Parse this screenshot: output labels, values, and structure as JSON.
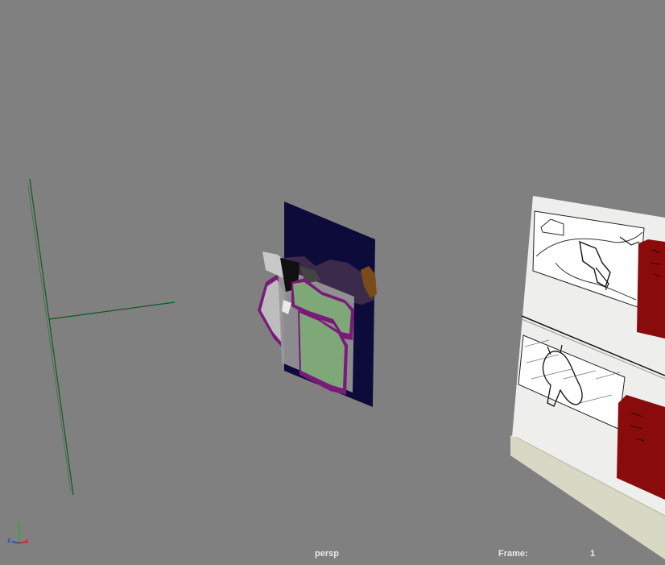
{
  "viewport": {
    "camera_name": "persp",
    "frame_label": "Frame:",
    "frame_value": "1"
  },
  "axis_gizmo": {
    "x_label": "x",
    "y_label": "y",
    "z_label": "z",
    "x_color": "#d02020",
    "y_color": "#20b020",
    "z_color": "#2040d0"
  },
  "colors": {
    "background": "#808080",
    "grid_line": "#0e5a1e",
    "dark_panel": "#0d0b3a",
    "card_red": "#8a0b0b",
    "storyboard_paper": "#f2f2f0",
    "green_shape": "#7fa878",
    "purple_edge": "#7a1a7a"
  }
}
